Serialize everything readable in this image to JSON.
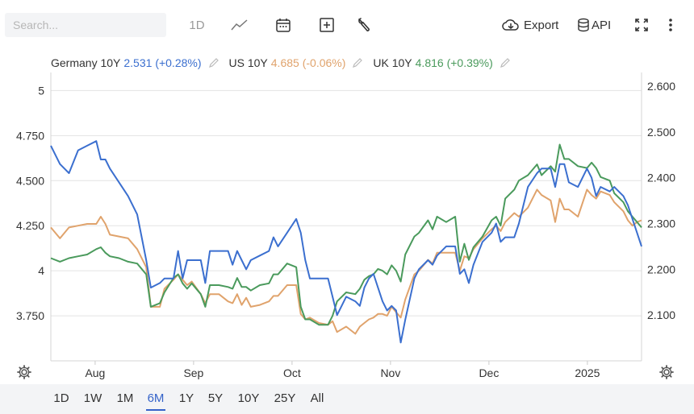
{
  "toolbar": {
    "search_placeholder": "Search...",
    "interval_label": "1D",
    "export_label": "Export",
    "api_label": "API",
    "icons": [
      "line-chart-icon",
      "calendar-icon",
      "plus-square-icon",
      "wrench-icon",
      "cloud-download-icon",
      "database-icon",
      "fullscreen-icon",
      "more-vertical-icon"
    ]
  },
  "legend": [
    {
      "name": "Germany 10Y",
      "value": "2.531",
      "change": "(+0.28%)",
      "color": "#3b6fcf"
    },
    {
      "name": "US 10Y",
      "value": "4.685",
      "change": "(-0.06%)",
      "color": "#e0a36c"
    },
    {
      "name": "UK 10Y",
      "value": "4.816",
      "change": "(+0.39%)",
      "color": "#4a9a5c"
    }
  ],
  "ranges": {
    "items": [
      "1D",
      "1W",
      "1M",
      "6M",
      "1Y",
      "5Y",
      "10Y",
      "25Y",
      "All"
    ],
    "active": "6M"
  },
  "chart_data": {
    "type": "line",
    "x_ticks": [
      "Aug",
      "Sep",
      "Oct",
      "Nov",
      "Dec",
      "2025"
    ],
    "left_axis": {
      "ticks": [
        "3.750",
        "4",
        "4.250",
        "4.500",
        "4.750",
        "5"
      ],
      "range": [
        3.5,
        5.1
      ]
    },
    "right_axis": {
      "ticks": [
        "2.100",
        "2.200",
        "2.300",
        "2.400",
        "2.500",
        "2.600"
      ],
      "range": [
        2.0,
        2.63
      ]
    },
    "x_range": [
      0,
      130
    ],
    "series": [
      {
        "name": "Germany 10Y",
        "axis": "right",
        "color": "#3b6fcf",
        "points": [
          [
            0,
            2.47
          ],
          [
            2,
            2.43
          ],
          [
            4,
            2.41
          ],
          [
            6,
            2.46
          ],
          [
            8,
            2.47
          ],
          [
            10,
            2.48
          ],
          [
            11,
            2.44
          ],
          [
            12,
            2.44
          ],
          [
            13,
            2.42
          ],
          [
            15,
            2.39
          ],
          [
            17,
            2.36
          ],
          [
            19,
            2.32
          ],
          [
            21,
            2.22
          ],
          [
            22,
            2.16
          ],
          [
            24,
            2.17
          ],
          [
            25,
            2.18
          ],
          [
            27,
            2.18
          ],
          [
            28,
            2.24
          ],
          [
            29,
            2.18
          ],
          [
            30,
            2.22
          ],
          [
            31,
            2.22
          ],
          [
            33,
            2.22
          ],
          [
            34,
            2.17
          ],
          [
            35,
            2.24
          ],
          [
            37,
            2.24
          ],
          [
            39,
            2.24
          ],
          [
            40,
            2.21
          ],
          [
            41,
            2.24
          ],
          [
            42,
            2.22
          ],
          [
            43,
            2.2
          ],
          [
            44,
            2.22
          ],
          [
            46,
            2.23
          ],
          [
            48,
            2.24
          ],
          [
            49,
            2.27
          ],
          [
            50,
            2.25
          ],
          [
            52,
            2.28
          ],
          [
            54,
            2.31
          ],
          [
            55,
            2.28
          ],
          [
            56,
            2.22
          ],
          [
            57,
            2.18
          ],
          [
            59,
            2.18
          ],
          [
            61,
            2.18
          ],
          [
            62,
            2.14
          ],
          [
            63,
            2.1
          ],
          [
            65,
            2.14
          ],
          [
            67,
            2.13
          ],
          [
            68,
            2.12
          ],
          [
            69,
            2.16
          ],
          [
            70,
            2.18
          ],
          [
            71,
            2.19
          ],
          [
            72,
            2.16
          ],
          [
            73,
            2.13
          ],
          [
            74,
            2.11
          ],
          [
            75,
            2.12
          ],
          [
            76,
            2.11
          ],
          [
            77,
            2.04
          ],
          [
            78,
            2.09
          ],
          [
            80,
            2.18
          ],
          [
            81,
            2.2
          ],
          [
            83,
            2.22
          ],
          [
            84,
            2.21
          ],
          [
            85,
            2.23
          ],
          [
            87,
            2.25
          ],
          [
            89,
            2.25
          ],
          [
            90,
            2.19
          ],
          [
            91,
            2.2
          ],
          [
            92,
            2.17
          ],
          [
            93,
            2.21
          ],
          [
            95,
            2.26
          ],
          [
            97,
            2.28
          ],
          [
            98,
            2.3
          ],
          [
            99,
            2.26
          ],
          [
            100,
            2.27
          ],
          [
            102,
            2.27
          ],
          [
            103,
            2.3
          ],
          [
            105,
            2.38
          ],
          [
            107,
            2.41
          ],
          [
            108,
            2.42
          ],
          [
            110,
            2.42
          ],
          [
            111,
            2.38
          ],
          [
            112,
            2.43
          ],
          [
            113,
            2.43
          ],
          [
            114,
            2.39
          ],
          [
            116,
            2.38
          ],
          [
            118,
            2.42
          ],
          [
            119,
            2.4
          ],
          [
            120,
            2.36
          ],
          [
            121,
            2.38
          ],
          [
            123,
            2.37
          ],
          [
            124,
            2.38
          ],
          [
            126,
            2.36
          ],
          [
            127,
            2.34
          ],
          [
            128,
            2.31
          ],
          [
            129,
            2.28
          ],
          [
            130,
            2.25
          ]
        ]
      },
      {
        "name": "US 10Y",
        "axis": "left",
        "color": "#e0a36c",
        "points": [
          [
            0,
            4.24
          ],
          [
            2,
            4.18
          ],
          [
            4,
            4.24
          ],
          [
            6,
            4.25
          ],
          [
            8,
            4.26
          ],
          [
            10,
            4.26
          ],
          [
            11,
            4.3
          ],
          [
            12,
            4.26
          ],
          [
            13,
            4.2
          ],
          [
            15,
            4.19
          ],
          [
            17,
            4.18
          ],
          [
            19,
            4.12
          ],
          [
            21,
            4.02
          ],
          [
            22,
            3.8
          ],
          [
            24,
            3.8
          ],
          [
            25,
            3.9
          ],
          [
            27,
            3.95
          ],
          [
            28,
            3.98
          ],
          [
            29,
            3.95
          ],
          [
            30,
            3.92
          ],
          [
            31,
            3.94
          ],
          [
            33,
            3.87
          ],
          [
            34,
            3.82
          ],
          [
            35,
            3.87
          ],
          [
            37,
            3.87
          ],
          [
            39,
            3.83
          ],
          [
            40,
            3.82
          ],
          [
            41,
            3.87
          ],
          [
            42,
            3.81
          ],
          [
            43,
            3.85
          ],
          [
            44,
            3.8
          ],
          [
            46,
            3.81
          ],
          [
            48,
            3.83
          ],
          [
            49,
            3.86
          ],
          [
            50,
            3.86
          ],
          [
            52,
            3.92
          ],
          [
            54,
            3.92
          ],
          [
            55,
            3.76
          ],
          [
            56,
            3.73
          ],
          [
            57,
            3.74
          ],
          [
            59,
            3.71
          ],
          [
            61,
            3.7
          ],
          [
            62,
            3.72
          ],
          [
            63,
            3.66
          ],
          [
            65,
            3.69
          ],
          [
            67,
            3.65
          ],
          [
            68,
            3.69
          ],
          [
            69,
            3.71
          ],
          [
            70,
            3.73
          ],
          [
            71,
            3.74
          ],
          [
            72,
            3.76
          ],
          [
            73,
            3.76
          ],
          [
            74,
            3.75
          ],
          [
            75,
            3.8
          ],
          [
            76,
            3.77
          ],
          [
            77,
            3.74
          ],
          [
            78,
            3.84
          ],
          [
            80,
            3.98
          ],
          [
            81,
            4.0
          ],
          [
            83,
            4.06
          ],
          [
            84,
            4.04
          ],
          [
            85,
            4.1
          ],
          [
            87,
            4.1
          ],
          [
            89,
            4.1
          ],
          [
            90,
            4.0
          ],
          [
            91,
            4.08
          ],
          [
            92,
            4.07
          ],
          [
            93,
            4.12
          ],
          [
            95,
            4.18
          ],
          [
            97,
            4.23
          ],
          [
            98,
            4.25
          ],
          [
            99,
            4.22
          ],
          [
            100,
            4.27
          ],
          [
            102,
            4.32
          ],
          [
            103,
            4.3
          ],
          [
            105,
            4.35
          ],
          [
            107,
            4.45
          ],
          [
            108,
            4.42
          ],
          [
            110,
            4.39
          ],
          [
            111,
            4.27
          ],
          [
            112,
            4.4
          ],
          [
            113,
            4.34
          ],
          [
            114,
            4.34
          ],
          [
            116,
            4.3
          ],
          [
            118,
            4.45
          ],
          [
            119,
            4.42
          ],
          [
            120,
            4.4
          ],
          [
            121,
            4.44
          ],
          [
            123,
            4.42
          ],
          [
            124,
            4.38
          ],
          [
            126,
            4.33
          ],
          [
            127,
            4.28
          ],
          [
            128,
            4.25
          ],
          [
            129,
            4.27
          ],
          [
            130,
            4.28
          ]
        ]
      },
      {
        "name": "UK 10Y",
        "axis": "left",
        "color": "#4a9a5c",
        "points": [
          [
            0,
            4.07
          ],
          [
            2,
            4.05
          ],
          [
            4,
            4.07
          ],
          [
            6,
            4.08
          ],
          [
            8,
            4.09
          ],
          [
            10,
            4.12
          ],
          [
            11,
            4.13
          ],
          [
            12,
            4.1
          ],
          [
            13,
            4.08
          ],
          [
            15,
            4.07
          ],
          [
            17,
            4.05
          ],
          [
            19,
            4.04
          ],
          [
            21,
            3.98
          ],
          [
            22,
            3.8
          ],
          [
            24,
            3.82
          ],
          [
            25,
            3.88
          ],
          [
            27,
            3.96
          ],
          [
            28,
            3.98
          ],
          [
            29,
            3.93
          ],
          [
            30,
            3.9
          ],
          [
            31,
            3.93
          ],
          [
            33,
            3.87
          ],
          [
            34,
            3.8
          ],
          [
            35,
            3.92
          ],
          [
            37,
            3.92
          ],
          [
            39,
            3.91
          ],
          [
            40,
            3.9
          ],
          [
            41,
            3.96
          ],
          [
            42,
            3.91
          ],
          [
            43,
            3.91
          ],
          [
            44,
            3.89
          ],
          [
            46,
            3.92
          ],
          [
            48,
            3.93
          ],
          [
            49,
            3.98
          ],
          [
            50,
            3.98
          ],
          [
            52,
            4.04
          ],
          [
            54,
            4.02
          ],
          [
            55,
            3.8
          ],
          [
            56,
            3.73
          ],
          [
            57,
            3.73
          ],
          [
            59,
            3.7
          ],
          [
            61,
            3.7
          ],
          [
            62,
            3.75
          ],
          [
            63,
            3.83
          ],
          [
            65,
            3.88
          ],
          [
            67,
            3.87
          ],
          [
            68,
            3.9
          ],
          [
            69,
            3.95
          ],
          [
            70,
            3.97
          ],
          [
            71,
            3.98
          ],
          [
            72,
            4.01
          ],
          [
            73,
            4.0
          ],
          [
            74,
            3.98
          ],
          [
            75,
            4.03
          ],
          [
            76,
            4.0
          ],
          [
            77,
            3.94
          ],
          [
            78,
            4.09
          ],
          [
            80,
            4.19
          ],
          [
            81,
            4.21
          ],
          [
            83,
            4.28
          ],
          [
            84,
            4.23
          ],
          [
            85,
            4.3
          ],
          [
            87,
            4.27
          ],
          [
            89,
            4.3
          ],
          [
            90,
            4.05
          ],
          [
            91,
            4.15
          ],
          [
            92,
            4.06
          ],
          [
            93,
            4.13
          ],
          [
            95,
            4.19
          ],
          [
            97,
            4.28
          ],
          [
            98,
            4.3
          ],
          [
            99,
            4.25
          ],
          [
            100,
            4.4
          ],
          [
            102,
            4.45
          ],
          [
            103,
            4.5
          ],
          [
            105,
            4.53
          ],
          [
            107,
            4.59
          ],
          [
            108,
            4.53
          ],
          [
            110,
            4.58
          ],
          [
            111,
            4.55
          ],
          [
            112,
            4.7
          ],
          [
            113,
            4.62
          ],
          [
            114,
            4.62
          ],
          [
            116,
            4.58
          ],
          [
            118,
            4.57
          ],
          [
            119,
            4.6
          ],
          [
            120,
            4.57
          ],
          [
            121,
            4.52
          ],
          [
            123,
            4.5
          ],
          [
            124,
            4.43
          ],
          [
            126,
            4.38
          ],
          [
            127,
            4.33
          ],
          [
            128,
            4.3
          ],
          [
            129,
            4.27
          ],
          [
            130,
            4.24
          ]
        ]
      }
    ]
  }
}
